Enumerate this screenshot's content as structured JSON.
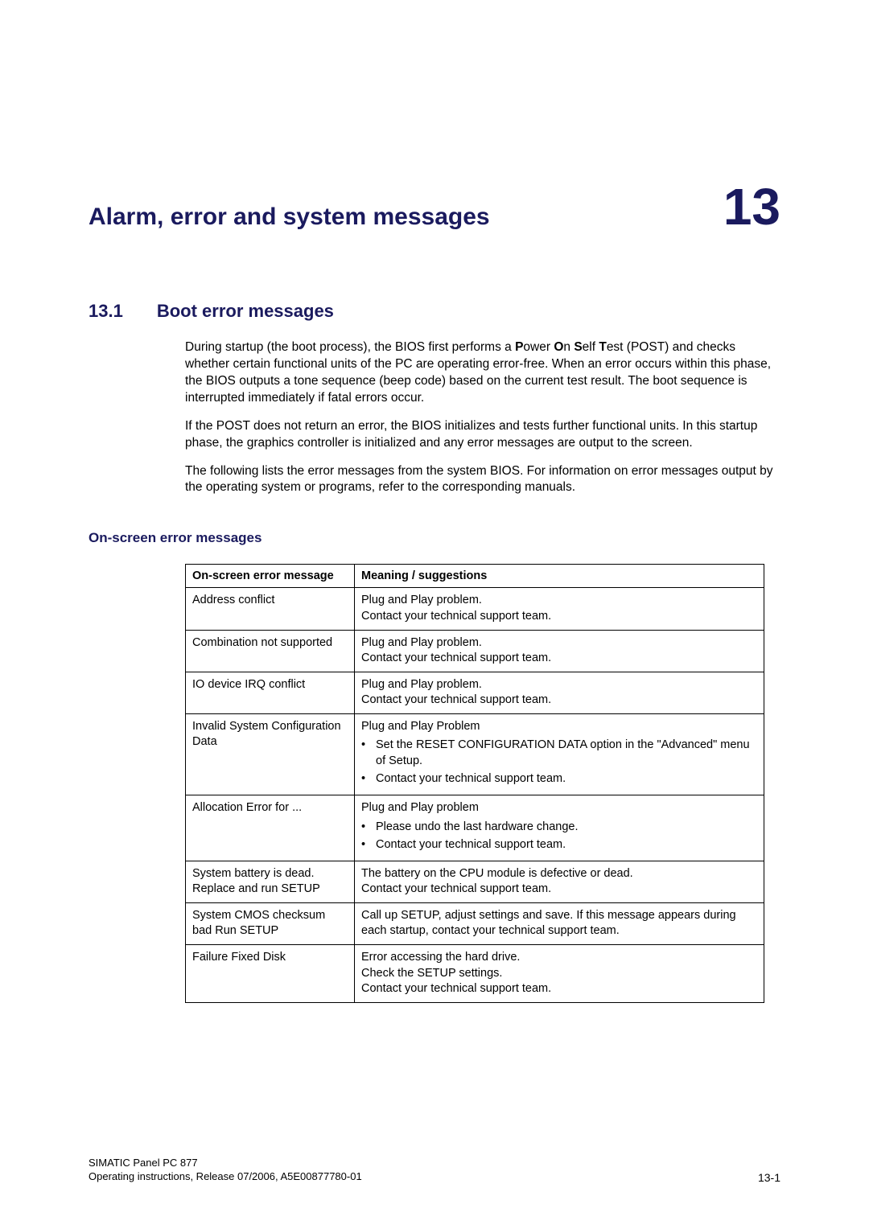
{
  "chapter": {
    "title": "Alarm, error and system messages",
    "number": "13"
  },
  "section": {
    "number": "13.1",
    "title": "Boot error messages"
  },
  "paragraphs": {
    "p1_prefix": "During startup (the boot process), the BIOS first performs a ",
    "p1_b1": "P",
    "p1_mid1": "ower ",
    "p1_b2": "O",
    "p1_mid2": "n ",
    "p1_b3": "S",
    "p1_mid3": "elf ",
    "p1_b4": "T",
    "p1_suffix": "est (POST) and checks whether certain functional units of the PC are operating error-free. When an error occurs within this phase, the BIOS outputs a tone sequence (beep code) based on the current test result. The boot sequence is interrupted immediately if fatal errors occur.",
    "p2": "If the POST does not return an error, the BIOS initializes and tests further functional units. In this startup phase, the graphics controller is initialized and any error messages are output to the screen.",
    "p3": "The following lists the error messages from the system BIOS. For information on error messages output by the operating system or programs, refer to the corresponding manuals."
  },
  "subsection_heading": "On-screen error messages",
  "table": {
    "header_col1": "On-screen error message",
    "header_col2": "Meaning / suggestions",
    "rows": [
      {
        "msg": "Address conflict",
        "meaning_lines": [
          "Plug and Play problem.",
          "Contact your technical support team."
        ]
      },
      {
        "msg": "Combination not supported",
        "meaning_lines": [
          "Plug and Play problem.",
          "Contact your technical support team."
        ]
      },
      {
        "msg": "IO device IRQ conflict",
        "meaning_lines": [
          "Plug and Play problem.",
          "Contact your technical support team."
        ]
      },
      {
        "msg": "Invalid System Configuration Data",
        "meaning_intro": "Plug and Play Problem",
        "bullets": [
          "Set the RESET CONFIGURATION DATA option in the \"Advanced\" menu of Setup.",
          "Contact your technical support team."
        ]
      },
      {
        "msg": "Allocation Error for ...",
        "meaning_intro": "Plug and Play problem",
        "bullets": [
          "Please undo the last hardware change.",
          "Contact your technical support team."
        ]
      },
      {
        "msg": "System battery is dead. Replace and run SETUP",
        "meaning_lines": [
          "The battery on the CPU module is defective or dead.",
          "Contact your technical support team."
        ]
      },
      {
        "msg": "System CMOS checksum bad Run SETUP",
        "meaning_lines": [
          "Call up SETUP, adjust settings and save. If this message appears during each startup, contact your technical support team."
        ]
      },
      {
        "msg": " Failure Fixed Disk",
        "meaning_lines": [
          "Error accessing the hard drive.",
          "Check the SETUP settings.",
          "Contact your technical support team."
        ]
      }
    ]
  },
  "footer": {
    "line1": "SIMATIC Panel PC 877",
    "line2": "Operating instructions, Release 07/2006, A5E00877780-01",
    "page": "13-1"
  }
}
